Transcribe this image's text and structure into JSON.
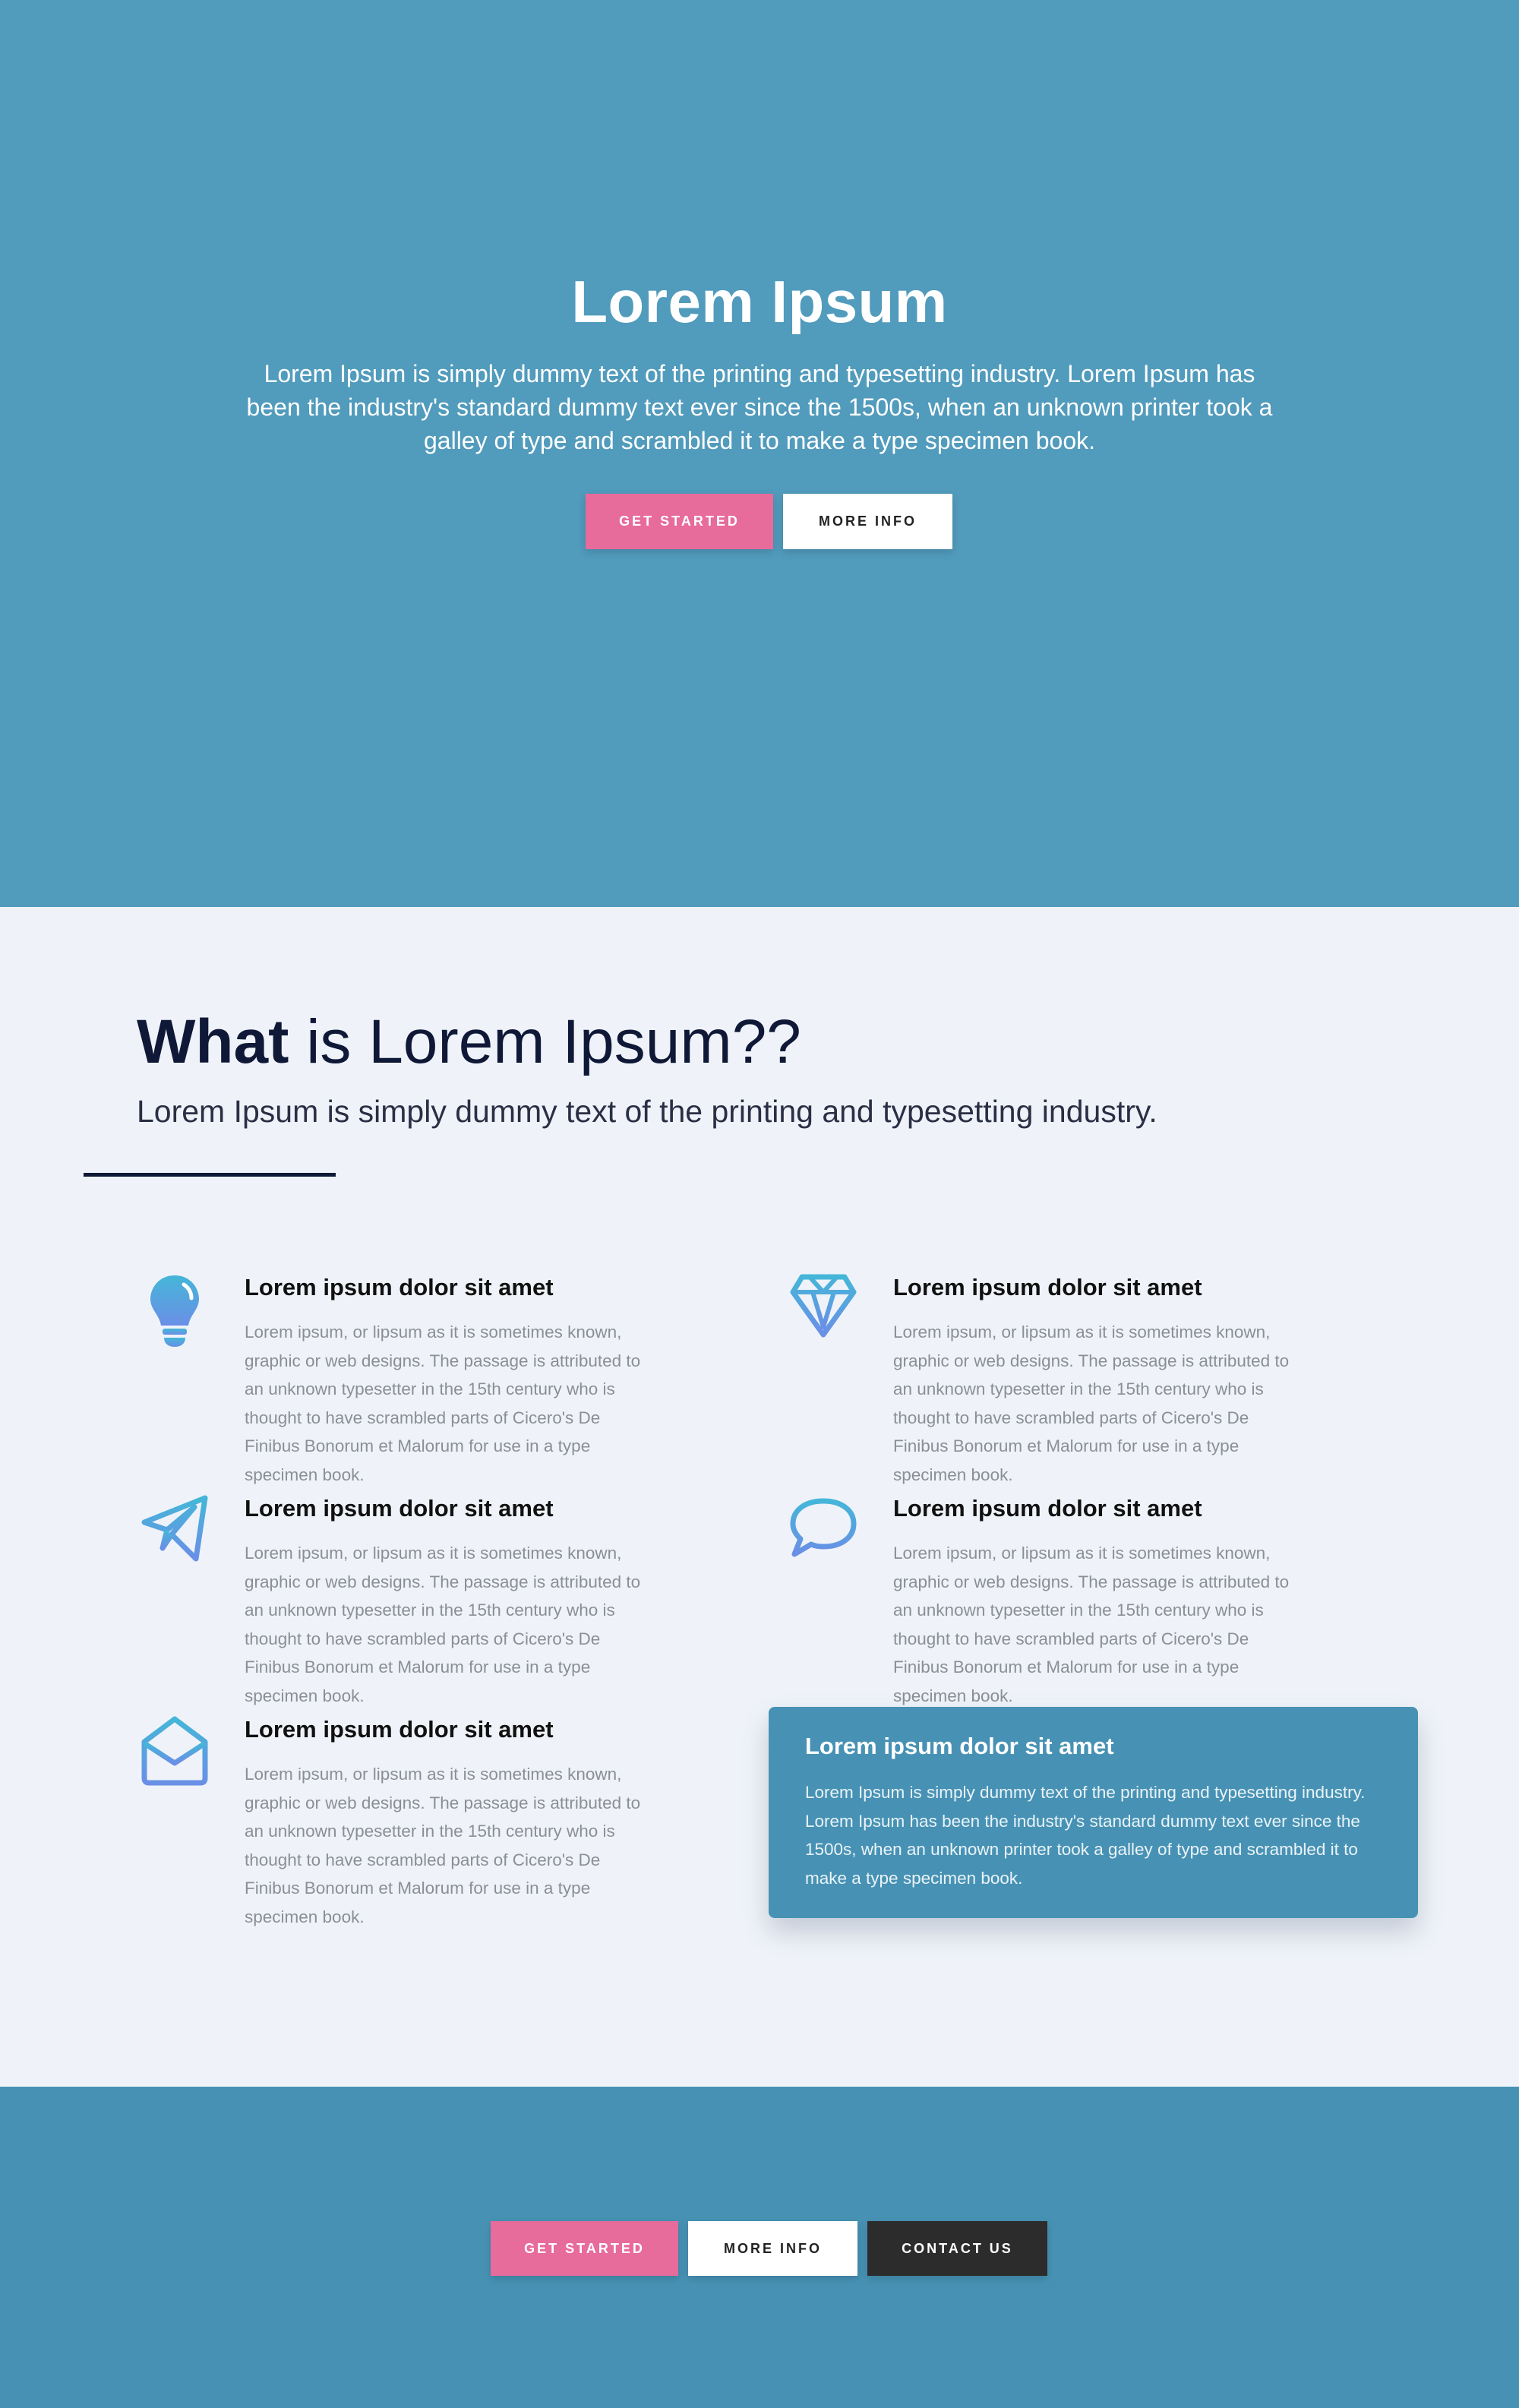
{
  "hero": {
    "title": "Lorem Ipsum",
    "description": "Lorem Ipsum is simply dummy text of the printing and typesetting industry. Lorem Ipsum has been the industry's standard dummy text ever since the 1500s, when an unknown printer took a galley of type and scrambled it to make a type specimen book.",
    "get_started_label": "GET STARTED",
    "more_info_label": "MORE INFO"
  },
  "what": {
    "title_bold": "What",
    "title_rest": " is Lorem Ipsum??",
    "subtitle": "Lorem Ipsum is simply dummy text of the printing and typesetting industry."
  },
  "features": [
    {
      "icon": "lightbulb-icon",
      "title": "Lorem ipsum dolor sit amet",
      "text": "Lorem ipsum, or lipsum as it is sometimes known, graphic or web designs. The passage is attributed to an unknown typesetter in the 15th century who is thought to have scrambled parts of Cicero's De Finibus Bonorum et Malorum for use in a type specimen book."
    },
    {
      "icon": "diamond-icon",
      "title": "Lorem ipsum dolor sit amet",
      "text": "Lorem ipsum, or lipsum as it is sometimes known, graphic or web designs. The passage is attributed to an unknown typesetter in the 15th century who is thought to have scrambled parts of Cicero's De Finibus Bonorum et Malorum for use in a type specimen book."
    },
    {
      "icon": "paper-plane-icon",
      "title": "Lorem ipsum dolor sit amet",
      "text": "Lorem ipsum, or lipsum as it is sometimes known, graphic or web designs. The passage is attributed to an unknown typesetter in the 15th century who is thought to have scrambled parts of Cicero's De Finibus Bonorum et Malorum for use in a type specimen book."
    },
    {
      "icon": "speech-bubble-icon",
      "title": "Lorem ipsum dolor sit amet",
      "text": "Lorem ipsum, or lipsum as it is sometimes known, graphic or web designs. The passage is attributed to an unknown typesetter in the 15th century who is thought to have scrambled parts of Cicero's De Finibus Bonorum et Malorum for use in a type specimen book."
    },
    {
      "icon": "envelope-open-icon",
      "title": "Lorem ipsum dolor sit amet",
      "text": "Lorem ipsum, or lipsum as it is sometimes known, graphic or web designs. The passage is attributed to an unknown typesetter in the 15th century who is thought to have scrambled parts of Cicero's De Finibus Bonorum et Malorum for use in a type specimen book."
    }
  ],
  "callout": {
    "title": "Lorem ipsum dolor sit amet",
    "text": "Lorem Ipsum is simply dummy text of the printing and typesetting industry. Lorem Ipsum has been the industry's standard dummy text ever since the 1500s, when an unknown printer took a galley of type and scrambled it to make a type specimen book."
  },
  "footer": {
    "get_started_label": "GET STARTED",
    "more_info_label": "MORE INFO",
    "contact_us_label": "CONTACT US"
  },
  "colors": {
    "hero_bg": "#519bbc",
    "section_bg": "#eff3f9",
    "footer_bg": "#4792b4",
    "accent_pink": "#e76b9b",
    "dark_button": "#2c2c2c",
    "navy_text": "#0f1836"
  }
}
